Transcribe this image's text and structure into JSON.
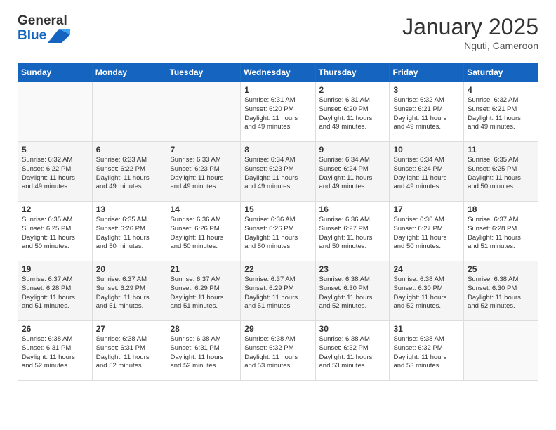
{
  "header": {
    "logo_general": "General",
    "logo_blue": "Blue",
    "title": "January 2025",
    "location": "Nguti, Cameroon"
  },
  "days_of_week": [
    "Sunday",
    "Monday",
    "Tuesday",
    "Wednesday",
    "Thursday",
    "Friday",
    "Saturday"
  ],
  "weeks": [
    [
      {
        "day": "",
        "info": ""
      },
      {
        "day": "",
        "info": ""
      },
      {
        "day": "",
        "info": ""
      },
      {
        "day": "1",
        "info": "Sunrise: 6:31 AM\nSunset: 6:20 PM\nDaylight: 11 hours\nand 49 minutes."
      },
      {
        "day": "2",
        "info": "Sunrise: 6:31 AM\nSunset: 6:20 PM\nDaylight: 11 hours\nand 49 minutes."
      },
      {
        "day": "3",
        "info": "Sunrise: 6:32 AM\nSunset: 6:21 PM\nDaylight: 11 hours\nand 49 minutes."
      },
      {
        "day": "4",
        "info": "Sunrise: 6:32 AM\nSunset: 6:21 PM\nDaylight: 11 hours\nand 49 minutes."
      }
    ],
    [
      {
        "day": "5",
        "info": "Sunrise: 6:32 AM\nSunset: 6:22 PM\nDaylight: 11 hours\nand 49 minutes."
      },
      {
        "day": "6",
        "info": "Sunrise: 6:33 AM\nSunset: 6:22 PM\nDaylight: 11 hours\nand 49 minutes."
      },
      {
        "day": "7",
        "info": "Sunrise: 6:33 AM\nSunset: 6:23 PM\nDaylight: 11 hours\nand 49 minutes."
      },
      {
        "day": "8",
        "info": "Sunrise: 6:34 AM\nSunset: 6:23 PM\nDaylight: 11 hours\nand 49 minutes."
      },
      {
        "day": "9",
        "info": "Sunrise: 6:34 AM\nSunset: 6:24 PM\nDaylight: 11 hours\nand 49 minutes."
      },
      {
        "day": "10",
        "info": "Sunrise: 6:34 AM\nSunset: 6:24 PM\nDaylight: 11 hours\nand 49 minutes."
      },
      {
        "day": "11",
        "info": "Sunrise: 6:35 AM\nSunset: 6:25 PM\nDaylight: 11 hours\nand 50 minutes."
      }
    ],
    [
      {
        "day": "12",
        "info": "Sunrise: 6:35 AM\nSunset: 6:25 PM\nDaylight: 11 hours\nand 50 minutes."
      },
      {
        "day": "13",
        "info": "Sunrise: 6:35 AM\nSunset: 6:26 PM\nDaylight: 11 hours\nand 50 minutes."
      },
      {
        "day": "14",
        "info": "Sunrise: 6:36 AM\nSunset: 6:26 PM\nDaylight: 11 hours\nand 50 minutes."
      },
      {
        "day": "15",
        "info": "Sunrise: 6:36 AM\nSunset: 6:26 PM\nDaylight: 11 hours\nand 50 minutes."
      },
      {
        "day": "16",
        "info": "Sunrise: 6:36 AM\nSunset: 6:27 PM\nDaylight: 11 hours\nand 50 minutes."
      },
      {
        "day": "17",
        "info": "Sunrise: 6:36 AM\nSunset: 6:27 PM\nDaylight: 11 hours\nand 50 minutes."
      },
      {
        "day": "18",
        "info": "Sunrise: 6:37 AM\nSunset: 6:28 PM\nDaylight: 11 hours\nand 51 minutes."
      }
    ],
    [
      {
        "day": "19",
        "info": "Sunrise: 6:37 AM\nSunset: 6:28 PM\nDaylight: 11 hours\nand 51 minutes."
      },
      {
        "day": "20",
        "info": "Sunrise: 6:37 AM\nSunset: 6:29 PM\nDaylight: 11 hours\nand 51 minutes."
      },
      {
        "day": "21",
        "info": "Sunrise: 6:37 AM\nSunset: 6:29 PM\nDaylight: 11 hours\nand 51 minutes."
      },
      {
        "day": "22",
        "info": "Sunrise: 6:37 AM\nSunset: 6:29 PM\nDaylight: 11 hours\nand 51 minutes."
      },
      {
        "day": "23",
        "info": "Sunrise: 6:38 AM\nSunset: 6:30 PM\nDaylight: 11 hours\nand 52 minutes."
      },
      {
        "day": "24",
        "info": "Sunrise: 6:38 AM\nSunset: 6:30 PM\nDaylight: 11 hours\nand 52 minutes."
      },
      {
        "day": "25",
        "info": "Sunrise: 6:38 AM\nSunset: 6:30 PM\nDaylight: 11 hours\nand 52 minutes."
      }
    ],
    [
      {
        "day": "26",
        "info": "Sunrise: 6:38 AM\nSunset: 6:31 PM\nDaylight: 11 hours\nand 52 minutes."
      },
      {
        "day": "27",
        "info": "Sunrise: 6:38 AM\nSunset: 6:31 PM\nDaylight: 11 hours\nand 52 minutes."
      },
      {
        "day": "28",
        "info": "Sunrise: 6:38 AM\nSunset: 6:31 PM\nDaylight: 11 hours\nand 52 minutes."
      },
      {
        "day": "29",
        "info": "Sunrise: 6:38 AM\nSunset: 6:32 PM\nDaylight: 11 hours\nand 53 minutes."
      },
      {
        "day": "30",
        "info": "Sunrise: 6:38 AM\nSunset: 6:32 PM\nDaylight: 11 hours\nand 53 minutes."
      },
      {
        "day": "31",
        "info": "Sunrise: 6:38 AM\nSunset: 6:32 PM\nDaylight: 11 hours\nand 53 minutes."
      },
      {
        "day": "",
        "info": ""
      }
    ]
  ]
}
